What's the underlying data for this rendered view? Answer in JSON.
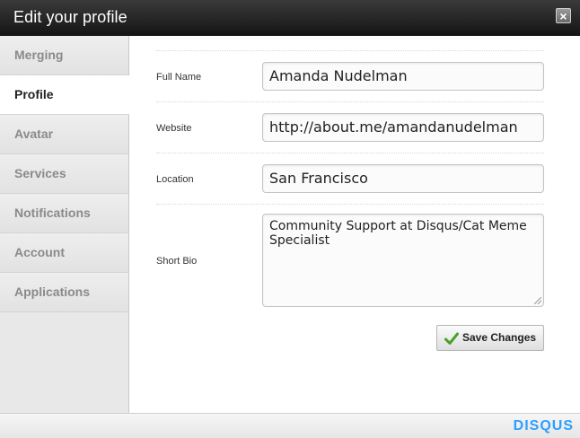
{
  "window": {
    "title": "Edit your profile",
    "close_label": "×"
  },
  "sidebar": {
    "items": [
      {
        "label": "Merging"
      },
      {
        "label": "Profile",
        "active": true
      },
      {
        "label": "Avatar"
      },
      {
        "label": "Services"
      },
      {
        "label": "Notifications"
      },
      {
        "label": "Account"
      },
      {
        "label": "Applications"
      }
    ]
  },
  "form": {
    "full_name": {
      "label": "Full Name",
      "value": "Amanda Nudelman"
    },
    "website": {
      "label": "Website",
      "value": "http://about.me/amandanudelman"
    },
    "location": {
      "label": "Location",
      "value": "San Francisco"
    },
    "bio": {
      "label": "Short Bio",
      "value": "Community Support at Disqus/Cat Meme Specialist"
    }
  },
  "actions": {
    "save_label": "Save Changes"
  },
  "footer": {
    "logo_text": "DISQUS"
  },
  "colors": {
    "brand": "#2e9fff",
    "check": "#4aa02c"
  },
  "icons": {
    "close": "close-icon",
    "save": "checkmark-icon"
  }
}
